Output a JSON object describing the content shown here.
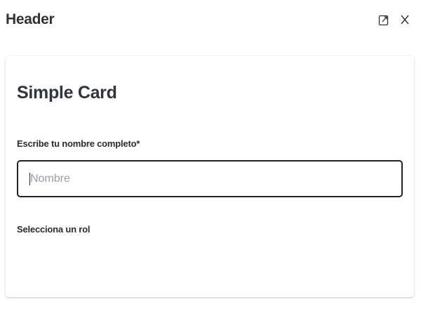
{
  "header": {
    "title": "Header",
    "actions": [
      {
        "icon": "expand-icon"
      },
      {
        "icon": "close-icon",
        "label": "X"
      }
    ]
  },
  "card": {
    "title": "Simple Card",
    "name_field": {
      "label": "Escribe tu nombre completo*",
      "placeholder": "Nombre",
      "value": ""
    },
    "role_field": {
      "label": "Selecciona un rol"
    }
  },
  "colors": {
    "text": "#2f3237",
    "input_border": "#1f2226",
    "placeholder": "#9aa0a8"
  }
}
